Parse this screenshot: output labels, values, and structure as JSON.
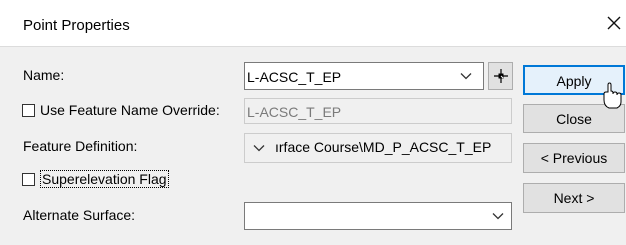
{
  "window": {
    "title": "Point Properties"
  },
  "fields": {
    "name_label": "Name:",
    "name_value": "L-ACSC_T_EP",
    "override_label": "Use Feature Name Override:",
    "override_value": "L-ACSC_T_EP",
    "feature_def_label": "Feature Definition:",
    "feature_def_value": "ırface Course\\MD_P_ACSC_T_EP",
    "superelevation_label": "Superelevation Flag",
    "alternate_label": "Alternate Surface:",
    "alternate_value": ""
  },
  "buttons": {
    "apply": "Apply",
    "close": "Close",
    "previous": "< Previous",
    "next": "Next >"
  },
  "icons": {
    "close": "close-icon",
    "dropdown": "chevron-down-icon",
    "pick": "crosshair-icon",
    "cursor": "mouse-pointer-icon"
  }
}
